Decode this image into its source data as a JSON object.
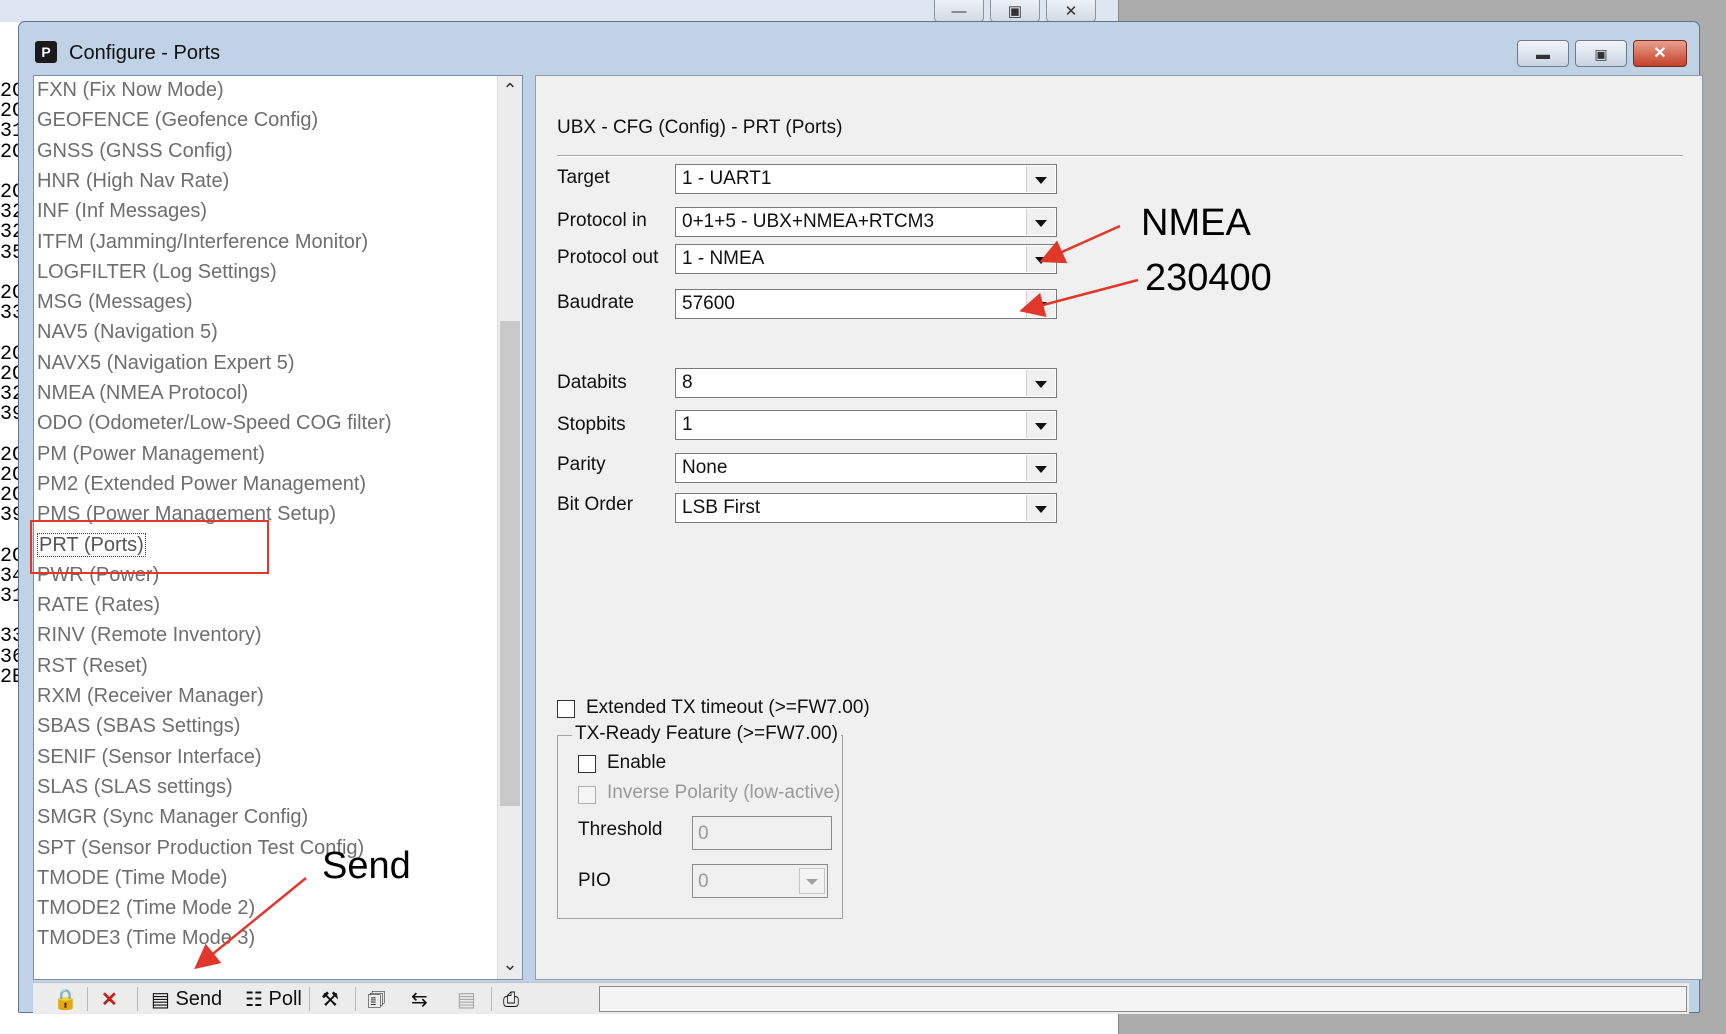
{
  "background": {
    "fragments": [
      "2C",
      "2C",
      "31",
      "2C",
      "",
      "2C",
      "32",
      "32",
      "35",
      "",
      "2C",
      "33",
      "",
      "2C",
      "2C",
      "32",
      "39",
      "",
      "2C",
      "2C",
      "2C",
      "39",
      "",
      "2C",
      "34",
      "31",
      "",
      "33",
      "36",
      "2E"
    ],
    "controls": [
      "minimize-icon",
      "restore-icon",
      "close-icon"
    ]
  },
  "window": {
    "title": "Configure - Ports",
    "icon_letter": "P"
  },
  "list": {
    "items": [
      "FXN (Fix Now Mode)",
      "GEOFENCE (Geofence Config)",
      "GNSS (GNSS Config)",
      "HNR (High Nav Rate)",
      "INF (Inf Messages)",
      "ITFM (Jamming/Interference Monitor)",
      "LOGFILTER (Log Settings)",
      "MSG (Messages)",
      "NAV5 (Navigation 5)",
      "NAVX5 (Navigation Expert 5)",
      "NMEA (NMEA Protocol)",
      "ODO (Odometer/Low-Speed COG filter)",
      "PM (Power Management)",
      "PM2 (Extended Power Management)",
      "PMS (Power Management Setup)",
      "PRT (Ports)",
      "PWR (Power)",
      "RATE (Rates)",
      "RINV (Remote Inventory)",
      "RST (Reset)",
      "RXM (Receiver Manager)",
      "SBAS (SBAS Settings)",
      "SENIF (Sensor Interface)",
      "SLAS (SLAS settings)",
      "SMGR (Sync Manager Config)",
      "SPT (Sensor Production Test Config)",
      "TMODE (Time Mode)",
      "TMODE2 (Time Mode 2)",
      "TMODE3 (Time Mode 3)"
    ],
    "selected": "PRT (Ports)"
  },
  "config": {
    "title": "UBX - CFG (Config) - PRT (Ports)",
    "fields": {
      "target": {
        "label": "Target",
        "value": "1 - UART1"
      },
      "protocol_in": {
        "label": "Protocol in",
        "value": "0+1+5 - UBX+NMEA+RTCM3"
      },
      "protocol_out": {
        "label": "Protocol out",
        "value": "1 - NMEA"
      },
      "baudrate": {
        "label": "Baudrate",
        "value": "57600"
      },
      "databits": {
        "label": "Databits",
        "value": "8"
      },
      "stopbits": {
        "label": "Stopbits",
        "value": "1"
      },
      "parity": {
        "label": "Parity",
        "value": "None"
      },
      "bit_order": {
        "label": "Bit Order",
        "value": "LSB First"
      }
    },
    "extended_tx_label": "Extended TX timeout (>=FW7.00)",
    "txready": {
      "legend": "TX-Ready Feature (>=FW7.00)",
      "enable_label": "Enable",
      "inverse_label": "Inverse Polarity (low-active)",
      "threshold_label": "Threshold",
      "threshold_value": "0",
      "pio_label": "PIO",
      "pio_value": "0"
    }
  },
  "toolbar": {
    "send_label": "Send",
    "poll_label": "Poll"
  },
  "annotations": {
    "nmea": "NMEA",
    "baud": "230400",
    "send": "Send",
    "color": "#e2382b"
  }
}
